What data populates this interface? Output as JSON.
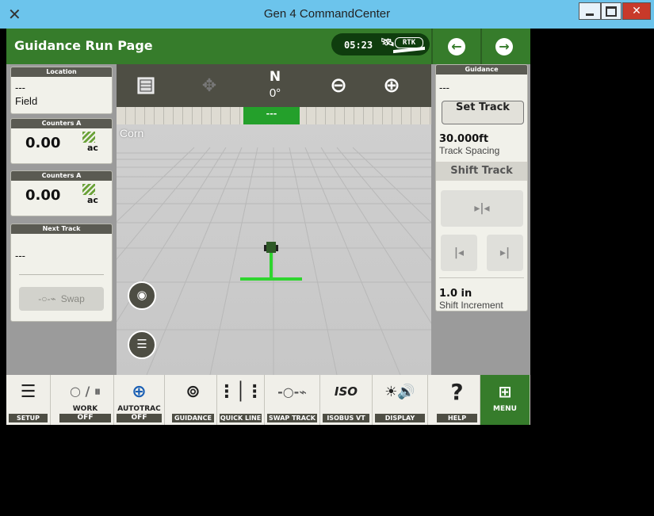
{
  "window": {
    "title": "Gen 4 CommandCenter",
    "app_icon": "x-logo-icon"
  },
  "header": {
    "title": "Guidance Run Page",
    "time": "05:23",
    "rtk_label": "RTK",
    "accent": "#367c2b"
  },
  "left_panel": {
    "location": {
      "header": "Location",
      "line1": "---",
      "line2": "Field"
    },
    "counter1": {
      "header": "Counters A",
      "value": "0.00",
      "unit": "ac"
    },
    "counter2": {
      "header": "Counters A",
      "value": "0.00",
      "unit": "ac"
    },
    "next_track": {
      "header": "Next Track",
      "value": "---",
      "swap_label": "Swap"
    }
  },
  "map": {
    "compass_dir": "N",
    "compass_deg": "0°",
    "lightbar_value": "---",
    "crop_label": "Corn"
  },
  "right_panel": {
    "header": "Guidance",
    "track_name": "---",
    "set_track_label": "Set Track",
    "track_spacing_value": "30.000ft",
    "track_spacing_label": "Track Spacing",
    "shift_track_label": "Shift Track",
    "shift_increment_value": "1.0 in",
    "shift_increment_label": "Shift Increment"
  },
  "bottom_bar": {
    "setup": "SETUP",
    "work": "WORK",
    "work_state": "OFF",
    "autotrac": "AUTOTRAC",
    "autotrac_state": "OFF",
    "guidance": "GUIDANCE",
    "quick_line": "QUICK LINE",
    "swap_track": "SWAP TRACK",
    "isobus_vt": "ISOBUS VT",
    "isobus_icon_text": "ISO",
    "display": "DISPLAY",
    "help": "HELP",
    "menu": "MENU"
  }
}
